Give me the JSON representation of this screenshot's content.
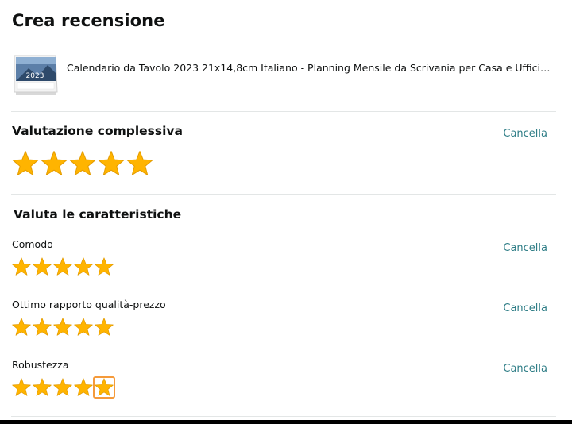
{
  "page": {
    "title": "Crea recensione"
  },
  "product": {
    "title": "Calendario da Tavolo 2023 21x14,8cm Italiano - Planning Mensile da Scrivania per Casa e Uffici…",
    "thumb_text": "2023"
  },
  "overall": {
    "heading": "Valutazione complessiva",
    "cancel_label": "Cancella",
    "rating": 5,
    "max": 5
  },
  "features": {
    "heading": "Valuta le caratteristiche",
    "items": [
      {
        "label": "Comodo",
        "cancel_label": "Cancella",
        "rating": 5,
        "max": 5
      },
      {
        "label": "Ottimo rapporto qualità-prezzo",
        "cancel_label": "Cancella",
        "rating": 5,
        "max": 5
      },
      {
        "label": "Robustezza",
        "cancel_label": "Cancella",
        "rating": 5,
        "max": 5,
        "focused_star": 5
      }
    ]
  },
  "colors": {
    "star_fill": "#ffb400",
    "star_stroke": "#e39b00",
    "link": "#2e7d86",
    "focus": "#f59a3a"
  }
}
